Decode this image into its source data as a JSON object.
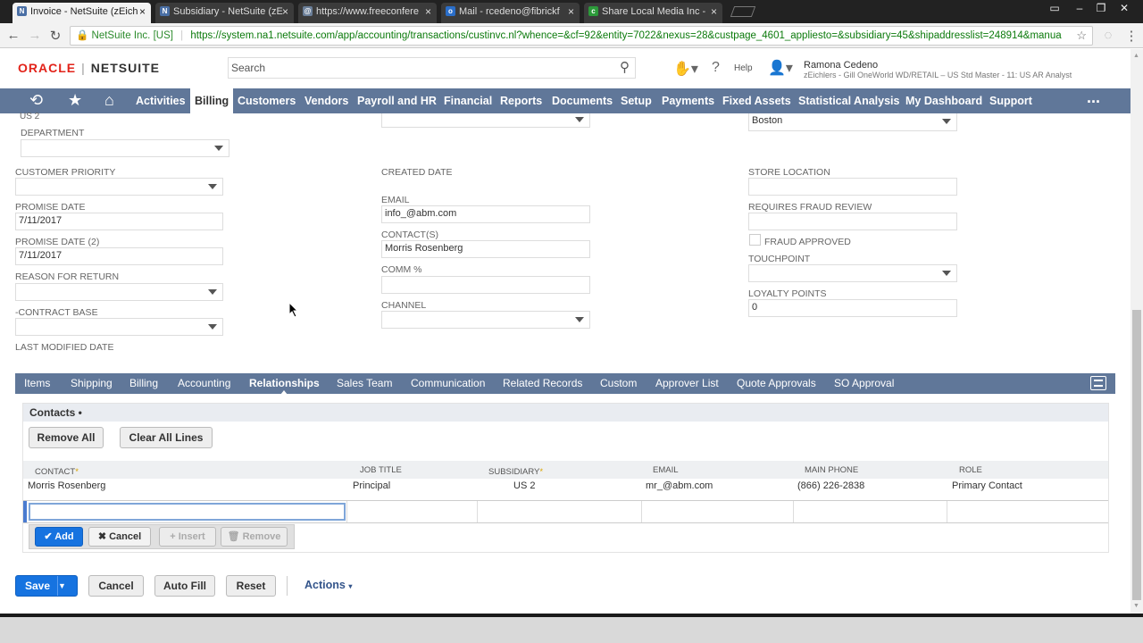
{
  "browser": {
    "tabs": [
      {
        "title": "Invoice - NetSuite (zEich",
        "icon": "N",
        "color": "#4a6fa5",
        "active": true
      },
      {
        "title": "Subsidiary - NetSuite (zE",
        "icon": "N",
        "color": "#4a6fa5",
        "active": false
      },
      {
        "title": "https://www.freeconfere",
        "icon": "@",
        "color": "#6b7f99",
        "active": false
      },
      {
        "title": "Mail - rcedeno@fibrickf",
        "icon": "o",
        "color": "#2a6ec9",
        "active": false
      },
      {
        "title": "Share Local Media Inc -",
        "icon": "c",
        "color": "#2c9a3a",
        "active": false
      }
    ],
    "secure_label": "NetSuite Inc. [US]",
    "url": "https://system.na1.netsuite.com/app/accounting/transactions/custinvc.nl?whence=&cf=92&entity=7022&nexus=28&custpage_4601_appliesto=&subsidiary=45&shipaddresslist=248914&manua"
  },
  "header": {
    "logo_oracle": "ORACLE",
    "logo_netsuite": "NETSUITE",
    "search_placeholder": "Search",
    "help": "Help",
    "user_name": "Ramona Cedeno",
    "user_role": "zEichlers - Gill OneWorld WD/RETAIL – US Std Master - 11: US AR Analyst"
  },
  "nav": {
    "items": [
      "Activities",
      "Billing",
      "Customers",
      "Vendors",
      "Payroll and HR",
      "Financial",
      "Reports",
      "Documents",
      "Setup",
      "Payments",
      "Fixed Assets",
      "Statistical Analysis",
      "My Dashboard",
      "Support"
    ],
    "selected": "Billing",
    "more": "..."
  },
  "form": {
    "partial_top_value": "US 2",
    "location_value": "Boston",
    "department_label": "DEPARTMENT",
    "customer_priority_label": "CUSTOMER PRIORITY",
    "promise_date_label": "PROMISE DATE",
    "promise_date_value": "7/11/2017",
    "promise_date2_label": "PROMISE DATE (2)",
    "promise_date2_value": "7/11/2017",
    "reason_for_return_label": "REASON FOR RETURN",
    "contract_base_label": "-CONTRACT BASE",
    "last_modified_label": "LAST MODIFIED DATE",
    "created_date_label": "CREATED DATE",
    "email_label": "EMAIL",
    "email_value": "info_@abm.com",
    "contacts_label": "CONTACT(S)",
    "contacts_value": "Morris Rosenberg",
    "comm_label": "COMM %",
    "channel_label": "CHANNEL",
    "store_location_label": "STORE LOCATION",
    "fraud_review_label": "REQUIRES FRAUD REVIEW",
    "fraud_approved_label": "FRAUD APPROVED",
    "touchpoint_label": "TOUCHPOINT",
    "loyalty_points_label": "LOYALTY POINTS",
    "loyalty_points_value": "0"
  },
  "subtabs": {
    "items": [
      "Items",
      "Shipping",
      "Billing",
      "Accounting",
      "Relationships",
      "Sales Team",
      "Communication",
      "Related Records",
      "Custom",
      "Approver List",
      "Quote Approvals",
      "SO Approval"
    ],
    "selected": "Relationships"
  },
  "contacts": {
    "section_title": "Contacts •",
    "remove_all": "Remove All",
    "clear_all_lines": "Clear All Lines",
    "columns": [
      "CONTACT",
      "JOB TITLE",
      "SUBSIDIARY",
      "EMAIL",
      "MAIN PHONE",
      "ROLE"
    ],
    "rows": [
      {
        "contact": "Morris Rosenberg",
        "job_title": "Principal",
        "subsidiary": "US 2",
        "email": "mr_@abm.com",
        "phone": "(866) 226-2838",
        "role": "Primary Contact"
      }
    ],
    "add": "Add",
    "cancel": "Cancel",
    "insert": "Insert",
    "remove": "Remove"
  },
  "footer": {
    "save": "Save",
    "cancel": "Cancel",
    "auto_fill": "Auto Fill",
    "reset": "Reset",
    "actions": "Actions"
  }
}
